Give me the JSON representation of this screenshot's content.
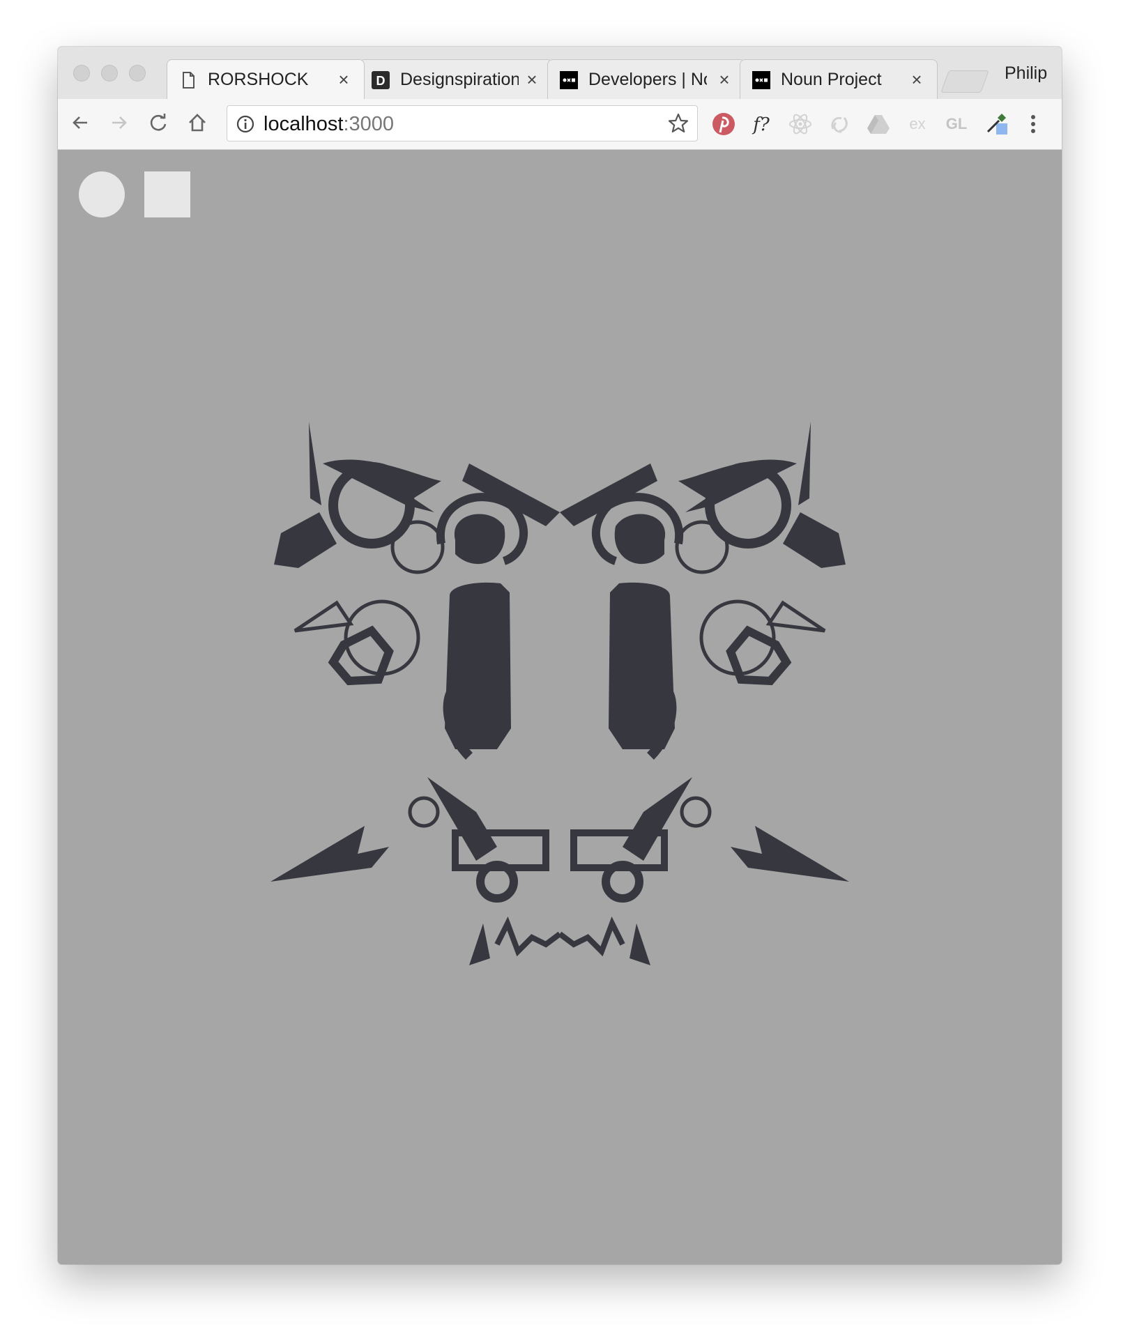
{
  "browser": {
    "tabs": [
      {
        "title": "RORSHOCK",
        "icon": "page-icon",
        "active": true
      },
      {
        "title": "Designspiration",
        "icon": "designspiration-icon",
        "active": false
      },
      {
        "title": "Developers | Noun Project",
        "icon": "noun-project-icon",
        "active": false
      },
      {
        "title": "Noun Project",
        "icon": "noun-project-icon",
        "active": false
      }
    ],
    "designspiration_glyph": "D",
    "tab_close": "×",
    "profile_name": "Philip",
    "address": {
      "host": "localhost",
      "port": ":3000"
    },
    "extensions": [
      "pinterest-icon",
      "font-identifier-icon",
      "react-devtools-icon",
      "redux-devtools-icon",
      "google-drive-icon",
      "ex-icon",
      "gl-icon",
      "eyedropper-icon",
      "more-icon"
    ],
    "ext_labels": {
      "font": "f?",
      "ex": "ex",
      "gl": "GL"
    }
  },
  "app": {
    "controls": [
      "circle-button",
      "square-button"
    ],
    "ink_color": "#373740",
    "background": "#a6a6a6",
    "control_color": "#e7e7e7"
  }
}
